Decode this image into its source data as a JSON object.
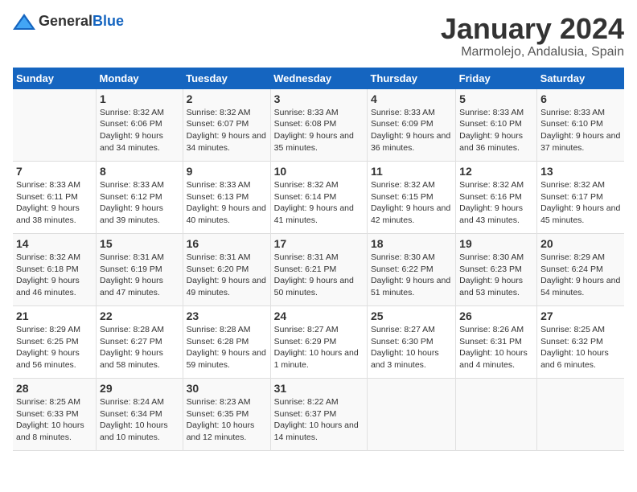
{
  "logo": {
    "general": "General",
    "blue": "Blue"
  },
  "title": "January 2024",
  "subtitle": "Marmolejo, Andalusia, Spain",
  "days_of_week": [
    "Sunday",
    "Monday",
    "Tuesday",
    "Wednesday",
    "Thursday",
    "Friday",
    "Saturday"
  ],
  "weeks": [
    [
      {
        "day": "",
        "sunrise": "",
        "sunset": "",
        "daylight": ""
      },
      {
        "day": "1",
        "sunrise": "Sunrise: 8:32 AM",
        "sunset": "Sunset: 6:06 PM",
        "daylight": "Daylight: 9 hours and 34 minutes."
      },
      {
        "day": "2",
        "sunrise": "Sunrise: 8:32 AM",
        "sunset": "Sunset: 6:07 PM",
        "daylight": "Daylight: 9 hours and 34 minutes."
      },
      {
        "day": "3",
        "sunrise": "Sunrise: 8:33 AM",
        "sunset": "Sunset: 6:08 PM",
        "daylight": "Daylight: 9 hours and 35 minutes."
      },
      {
        "day": "4",
        "sunrise": "Sunrise: 8:33 AM",
        "sunset": "Sunset: 6:09 PM",
        "daylight": "Daylight: 9 hours and 36 minutes."
      },
      {
        "day": "5",
        "sunrise": "Sunrise: 8:33 AM",
        "sunset": "Sunset: 6:10 PM",
        "daylight": "Daylight: 9 hours and 36 minutes."
      },
      {
        "day": "6",
        "sunrise": "Sunrise: 8:33 AM",
        "sunset": "Sunset: 6:10 PM",
        "daylight": "Daylight: 9 hours and 37 minutes."
      }
    ],
    [
      {
        "day": "7",
        "sunrise": "Sunrise: 8:33 AM",
        "sunset": "Sunset: 6:11 PM",
        "daylight": "Daylight: 9 hours and 38 minutes."
      },
      {
        "day": "8",
        "sunrise": "Sunrise: 8:33 AM",
        "sunset": "Sunset: 6:12 PM",
        "daylight": "Daylight: 9 hours and 39 minutes."
      },
      {
        "day": "9",
        "sunrise": "Sunrise: 8:33 AM",
        "sunset": "Sunset: 6:13 PM",
        "daylight": "Daylight: 9 hours and 40 minutes."
      },
      {
        "day": "10",
        "sunrise": "Sunrise: 8:32 AM",
        "sunset": "Sunset: 6:14 PM",
        "daylight": "Daylight: 9 hours and 41 minutes."
      },
      {
        "day": "11",
        "sunrise": "Sunrise: 8:32 AM",
        "sunset": "Sunset: 6:15 PM",
        "daylight": "Daylight: 9 hours and 42 minutes."
      },
      {
        "day": "12",
        "sunrise": "Sunrise: 8:32 AM",
        "sunset": "Sunset: 6:16 PM",
        "daylight": "Daylight: 9 hours and 43 minutes."
      },
      {
        "day": "13",
        "sunrise": "Sunrise: 8:32 AM",
        "sunset": "Sunset: 6:17 PM",
        "daylight": "Daylight: 9 hours and 45 minutes."
      }
    ],
    [
      {
        "day": "14",
        "sunrise": "Sunrise: 8:32 AM",
        "sunset": "Sunset: 6:18 PM",
        "daylight": "Daylight: 9 hours and 46 minutes."
      },
      {
        "day": "15",
        "sunrise": "Sunrise: 8:31 AM",
        "sunset": "Sunset: 6:19 PM",
        "daylight": "Daylight: 9 hours and 47 minutes."
      },
      {
        "day": "16",
        "sunrise": "Sunrise: 8:31 AM",
        "sunset": "Sunset: 6:20 PM",
        "daylight": "Daylight: 9 hours and 49 minutes."
      },
      {
        "day": "17",
        "sunrise": "Sunrise: 8:31 AM",
        "sunset": "Sunset: 6:21 PM",
        "daylight": "Daylight: 9 hours and 50 minutes."
      },
      {
        "day": "18",
        "sunrise": "Sunrise: 8:30 AM",
        "sunset": "Sunset: 6:22 PM",
        "daylight": "Daylight: 9 hours and 51 minutes."
      },
      {
        "day": "19",
        "sunrise": "Sunrise: 8:30 AM",
        "sunset": "Sunset: 6:23 PM",
        "daylight": "Daylight: 9 hours and 53 minutes."
      },
      {
        "day": "20",
        "sunrise": "Sunrise: 8:29 AM",
        "sunset": "Sunset: 6:24 PM",
        "daylight": "Daylight: 9 hours and 54 minutes."
      }
    ],
    [
      {
        "day": "21",
        "sunrise": "Sunrise: 8:29 AM",
        "sunset": "Sunset: 6:25 PM",
        "daylight": "Daylight: 9 hours and 56 minutes."
      },
      {
        "day": "22",
        "sunrise": "Sunrise: 8:28 AM",
        "sunset": "Sunset: 6:27 PM",
        "daylight": "Daylight: 9 hours and 58 minutes."
      },
      {
        "day": "23",
        "sunrise": "Sunrise: 8:28 AM",
        "sunset": "Sunset: 6:28 PM",
        "daylight": "Daylight: 9 hours and 59 minutes."
      },
      {
        "day": "24",
        "sunrise": "Sunrise: 8:27 AM",
        "sunset": "Sunset: 6:29 PM",
        "daylight": "Daylight: 10 hours and 1 minute."
      },
      {
        "day": "25",
        "sunrise": "Sunrise: 8:27 AM",
        "sunset": "Sunset: 6:30 PM",
        "daylight": "Daylight: 10 hours and 3 minutes."
      },
      {
        "day": "26",
        "sunrise": "Sunrise: 8:26 AM",
        "sunset": "Sunset: 6:31 PM",
        "daylight": "Daylight: 10 hours and 4 minutes."
      },
      {
        "day": "27",
        "sunrise": "Sunrise: 8:25 AM",
        "sunset": "Sunset: 6:32 PM",
        "daylight": "Daylight: 10 hours and 6 minutes."
      }
    ],
    [
      {
        "day": "28",
        "sunrise": "Sunrise: 8:25 AM",
        "sunset": "Sunset: 6:33 PM",
        "daylight": "Daylight: 10 hours and 8 minutes."
      },
      {
        "day": "29",
        "sunrise": "Sunrise: 8:24 AM",
        "sunset": "Sunset: 6:34 PM",
        "daylight": "Daylight: 10 hours and 10 minutes."
      },
      {
        "day": "30",
        "sunrise": "Sunrise: 8:23 AM",
        "sunset": "Sunset: 6:35 PM",
        "daylight": "Daylight: 10 hours and 12 minutes."
      },
      {
        "day": "31",
        "sunrise": "Sunrise: 8:22 AM",
        "sunset": "Sunset: 6:37 PM",
        "daylight": "Daylight: 10 hours and 14 minutes."
      },
      {
        "day": "",
        "sunrise": "",
        "sunset": "",
        "daylight": ""
      },
      {
        "day": "",
        "sunrise": "",
        "sunset": "",
        "daylight": ""
      },
      {
        "day": "",
        "sunrise": "",
        "sunset": "",
        "daylight": ""
      }
    ]
  ]
}
